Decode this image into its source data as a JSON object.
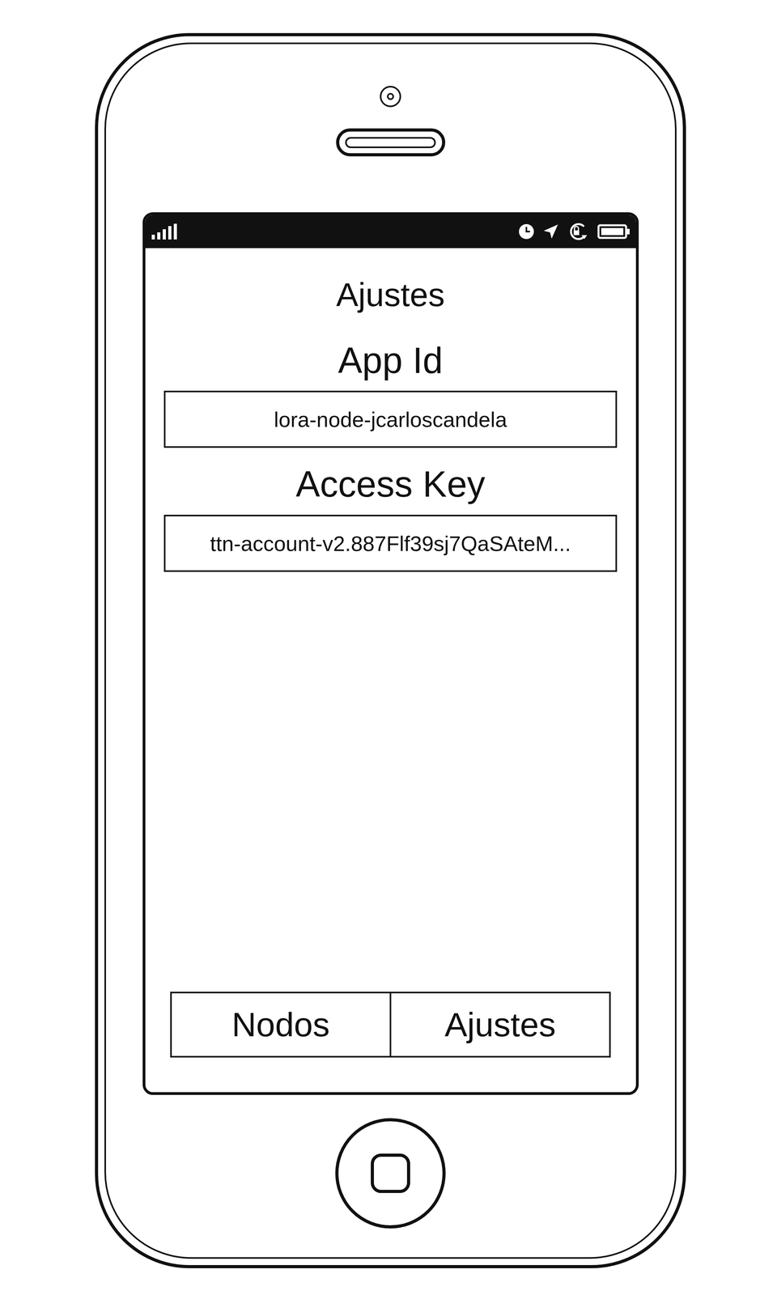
{
  "screen": {
    "title": "Ajustes"
  },
  "fields": [
    {
      "label": "App Id",
      "value": "lora-node-jcarloscandela"
    },
    {
      "label": "Access Key",
      "value": "ttn-account-v2.887Flf39sj7QaSAteM..."
    }
  ],
  "tabs": [
    {
      "label": "Nodos"
    },
    {
      "label": "Ajustes"
    }
  ]
}
